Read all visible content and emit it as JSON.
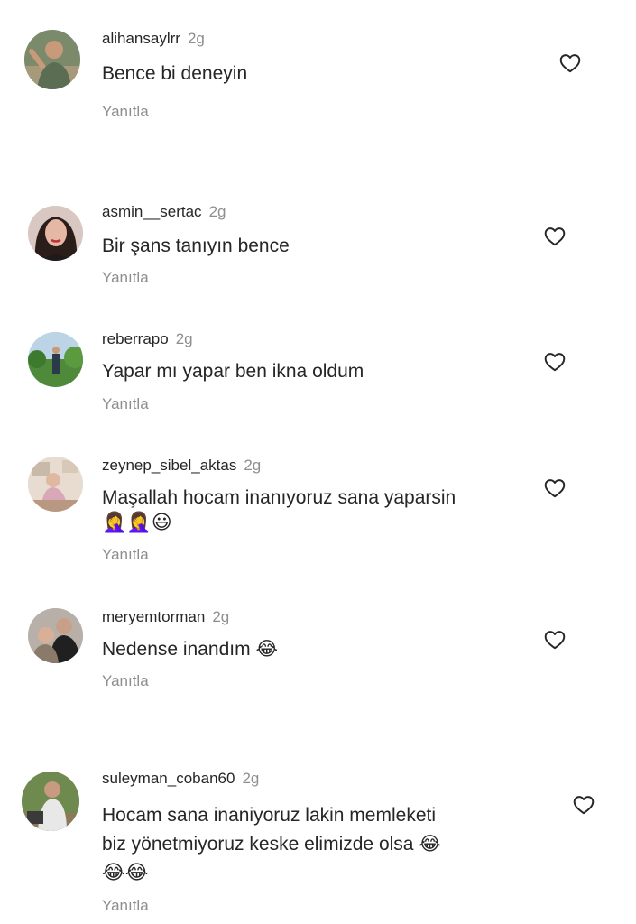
{
  "comments": [
    {
      "username": "alihansaylrr",
      "time": "2g",
      "text": "Bence bi deneyin",
      "reply": "Yanıtla"
    },
    {
      "username": "asmin__sertac",
      "time": "2g",
      "text": "Bir şans tanıyın bence",
      "reply": "Yanıtla"
    },
    {
      "username": "reberrapo",
      "time": "2g",
      "text": "Yapar mı yapar  ben ikna oldum",
      "reply": "Yanıtla"
    },
    {
      "username": "zeynep_sibel_aktas",
      "time": "2g",
      "text": "Maşallah hocam inanıyoruz sana yaparsin",
      "emoji_line": "🤦‍♀️🤦‍♀️😃",
      "reply": "Yanıtla"
    },
    {
      "username": "meryemtorman",
      "time": "2g",
      "text": "Nedense inandım 😂",
      "reply": "Yanıtla"
    },
    {
      "username": "suleyman_coban60",
      "time": "2g",
      "text_line1": "Hocam sana inaniyoruz lakin memleketi",
      "text_line2": "biz yönetmiyoruz keske elimizde olsa 😂",
      "emoji_line": "😂😂",
      "reply": "Yanıtla"
    }
  ],
  "icons": {
    "like": "heart-outline-icon",
    "avatar": "user-avatar"
  },
  "colors": {
    "text": "#262626",
    "secondary": "#8e8e8e",
    "background": "#ffffff"
  }
}
